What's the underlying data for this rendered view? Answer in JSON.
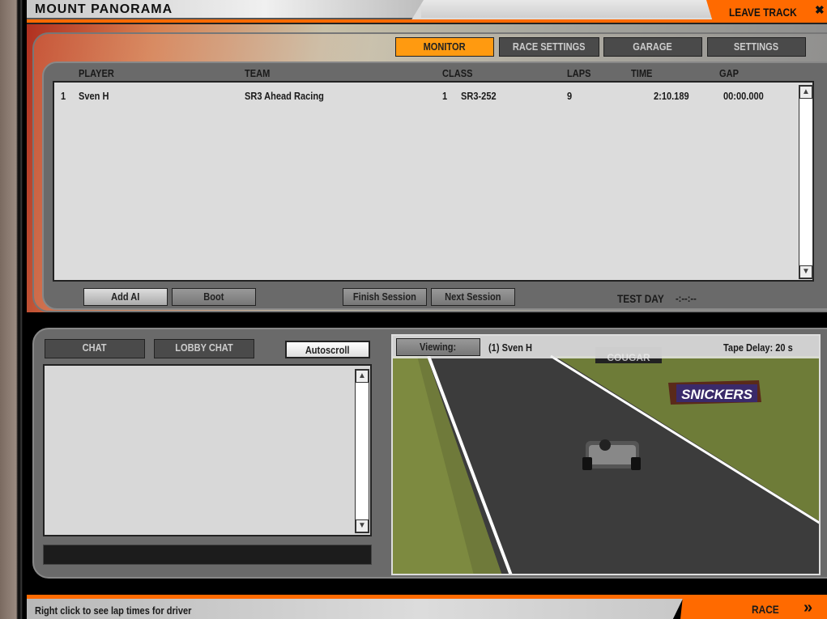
{
  "header": {
    "track_name": "MOUNT PANORAMA",
    "leave_track": "LEAVE TRACK"
  },
  "tabs": [
    {
      "label": "MONITOR",
      "active": true
    },
    {
      "label": "RACE SETTINGS"
    },
    {
      "label": "GARAGE"
    },
    {
      "label": "SETTINGS"
    }
  ],
  "table": {
    "columns": [
      "PLAYER",
      "TEAM",
      "CLASS",
      "LAPS",
      "TIME",
      "GAP"
    ],
    "rows": [
      {
        "pos": "1",
        "player": "Sven H",
        "team": "SR3 Ahead Racing",
        "class_pos": "1",
        "class": "SR3-252",
        "laps": "9",
        "time": "2:10.189",
        "gap": "00:00.000"
      }
    ]
  },
  "buttons": {
    "add_ai": "Add AI",
    "boot": "Boot",
    "finish_session": "Finish Session",
    "next_session": "Next Session"
  },
  "session": {
    "name": "TEST DAY",
    "time": "-:--:--"
  },
  "chat": {
    "chat_tab": "CHAT",
    "lobby_tab": "LOBBY CHAT",
    "autoscroll": "Autoscroll"
  },
  "viewer": {
    "viewing_label": "Viewing:",
    "viewing_driver": "(1) Sven H",
    "tape_delay": "Tape Delay: 20 s",
    "signs": [
      "COUGAR",
      "COUGAR",
      "SNICKERS"
    ]
  },
  "status": {
    "hint": "Right click to see lap times for driver",
    "race": "RACE"
  },
  "colors": {
    "accent": "#ff6a00",
    "active_tab": "#ff9a10"
  }
}
